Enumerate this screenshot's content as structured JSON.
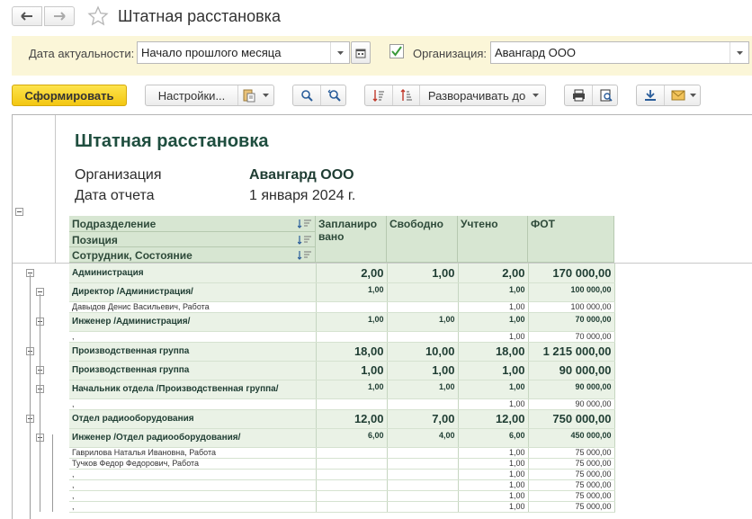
{
  "window": {
    "title": "Штатная расстановка"
  },
  "filters": {
    "date_label": "Дата актуальности:",
    "date_value": "Начало прошлого месяца",
    "org_label": "Организация:",
    "org_value": "Авангард ООО",
    "org_checked": true
  },
  "toolbar": {
    "generate_label": "Сформировать",
    "settings_label": "Настройки...",
    "expand_label": "Разворачивать до"
  },
  "report": {
    "title": "Штатная расстановка",
    "org_label": "Организация",
    "org_value": "Авангард ООО",
    "date_label": "Дата отчета",
    "date_value": "1 января 2024 г.",
    "headers": {
      "division": "Подразделение",
      "position": "Позиция",
      "employee": "Сотрудник, Состояние",
      "planned": "Запланиро вано",
      "free": "Свободно",
      "counted": "Учтено",
      "fot": "ФОТ"
    },
    "rows": [
      {
        "level": "g1",
        "name": "Администрация",
        "planned": "2,00",
        "free": "1,00",
        "counted": "2,00",
        "fot": "170 000,00"
      },
      {
        "level": "g2",
        "name": "Директор /Администрация/",
        "planned": "1,00",
        "free": "",
        "counted": "1,00",
        "fot": "100 000,00"
      },
      {
        "level": "d",
        "name": "Давыдов Денис Васильевич, Работа",
        "planned": "",
        "free": "",
        "counted": "1,00",
        "fot": "100 000,00"
      },
      {
        "level": "g2",
        "name": "Инженер /Администрация/",
        "planned": "1,00",
        "free": "1,00",
        "counted": "1,00",
        "fot": "70 000,00"
      },
      {
        "level": "d",
        "name": ",",
        "planned": "",
        "free": "",
        "counted": "1,00",
        "fot": "70 000,00"
      },
      {
        "level": "g1",
        "name": "Производственная группа",
        "planned": "18,00",
        "free": "10,00",
        "counted": "18,00",
        "fot": "1 215 000,00"
      },
      {
        "level": "g2big",
        "name": "Производственная группа",
        "planned": "1,00",
        "free": "1,00",
        "counted": "1,00",
        "fot": "90 000,00"
      },
      {
        "level": "g2",
        "name": "Начальник отдела /Производственная группа/",
        "planned": "1,00",
        "free": "1,00",
        "counted": "1,00",
        "fot": "90 000,00"
      },
      {
        "level": "d",
        "name": ",",
        "planned": "",
        "free": "",
        "counted": "1,00",
        "fot": "90 000,00"
      },
      {
        "level": "g1",
        "name": "Отдел радиооборудования",
        "planned": "12,00",
        "free": "7,00",
        "counted": "12,00",
        "fot": "750 000,00"
      },
      {
        "level": "g2",
        "name": "Инженер /Отдел радиооборудования/",
        "planned": "6,00",
        "free": "4,00",
        "counted": "6,00",
        "fot": "450 000,00"
      },
      {
        "level": "d",
        "name": "Гаврилова Наталья Ивановна, Работа",
        "planned": "",
        "free": "",
        "counted": "1,00",
        "fot": "75 000,00"
      },
      {
        "level": "d",
        "name": "Тучков Федор Федорович, Работа",
        "planned": "",
        "free": "",
        "counted": "1,00",
        "fot": "75 000,00"
      },
      {
        "level": "d",
        "name": ",",
        "planned": "",
        "free": "",
        "counted": "1,00",
        "fot": "75 000,00"
      },
      {
        "level": "d",
        "name": ",",
        "planned": "",
        "free": "",
        "counted": "1,00",
        "fot": "75 000,00"
      },
      {
        "level": "d",
        "name": ",",
        "planned": "",
        "free": "",
        "counted": "1,00",
        "fot": "75 000,00"
      },
      {
        "level": "d",
        "name": ",",
        "planned": "",
        "free": "",
        "counted": "1,00",
        "fot": "75 000,00"
      }
    ]
  }
}
